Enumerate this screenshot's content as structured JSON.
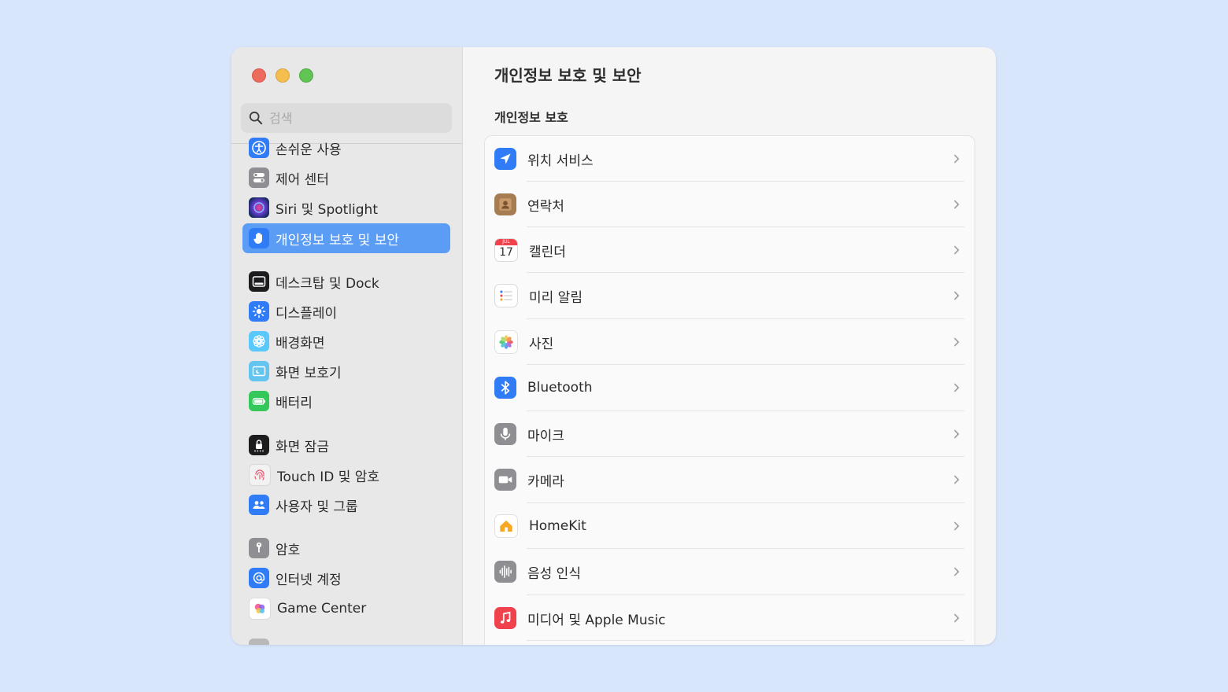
{
  "window_controls": {
    "close": "close",
    "minimize": "minimize",
    "zoom": "zoom"
  },
  "search": {
    "placeholder": "검색"
  },
  "sidebar": {
    "items": [
      {
        "label": "손쉬운 사용",
        "icon": "accessibility-icon",
        "color": "#2f7cf6"
      },
      {
        "label": "제어 센터",
        "icon": "control-center-icon",
        "color": "#8e8e93"
      },
      {
        "label": "Siri 및 Spotlight",
        "icon": "siri-icon",
        "color": "#3b2b6e"
      },
      {
        "label": "개인정보 보호 및 보안",
        "icon": "hand-icon",
        "color": "#2f7cf6",
        "selected": true
      },
      {
        "label": "데스크탑 및 Dock",
        "icon": "dock-icon",
        "color": "#1c1c1e"
      },
      {
        "label": "디스플레이",
        "icon": "display-icon",
        "color": "#2f7cf6"
      },
      {
        "label": "배경화면",
        "icon": "wallpaper-icon",
        "color": "#5ac8fa"
      },
      {
        "label": "화면 보호기",
        "icon": "screensaver-icon",
        "color": "#64c4f0"
      },
      {
        "label": "배터리",
        "icon": "battery-icon",
        "color": "#34c759"
      },
      {
        "label": "화면 잠금",
        "icon": "lock-icon",
        "color": "#1c1c1e"
      },
      {
        "label": "Touch ID 및 암호",
        "icon": "fingerprint-icon",
        "color": "#f2f2f2"
      },
      {
        "label": "사용자 및 그룹",
        "icon": "users-icon",
        "color": "#2f7cf6"
      },
      {
        "label": "암호",
        "icon": "key-icon",
        "color": "#8e8e93"
      },
      {
        "label": "인터넷 계정",
        "icon": "at-icon",
        "color": "#2f7cf6"
      },
      {
        "label": "Game Center",
        "icon": "game-center-icon",
        "color": "#ffffff"
      }
    ]
  },
  "main": {
    "title": "개인정보 보호 및 보안",
    "section_title": "개인정보 보호",
    "rows": [
      {
        "label": "위치 서비스",
        "icon": "location-icon",
        "color": "#2f7cf6"
      },
      {
        "label": "연락처",
        "icon": "contacts-icon",
        "color": "#a67c52"
      },
      {
        "label": "캘린더",
        "icon": "calendar-icon",
        "color": "#ffffff",
        "badge_month": "JUL",
        "badge_day": "17"
      },
      {
        "label": "미리 알림",
        "icon": "reminders-icon",
        "color": "#ffffff"
      },
      {
        "label": "사진",
        "icon": "photos-icon",
        "color": "#ffffff"
      },
      {
        "label": "Bluetooth",
        "icon": "bluetooth-icon",
        "color": "#2f7cf6"
      },
      {
        "label": "마이크",
        "icon": "microphone-icon",
        "color": "#8e8e93"
      },
      {
        "label": "카메라",
        "icon": "camera-icon",
        "color": "#8e8e93"
      },
      {
        "label": "HomeKit",
        "icon": "home-icon",
        "color": "#ffffff"
      },
      {
        "label": "음성 인식",
        "icon": "speech-icon",
        "color": "#8e8e93"
      },
      {
        "label": "미디어 및 Apple Music",
        "icon": "music-icon",
        "color": "#f0424d"
      }
    ]
  }
}
